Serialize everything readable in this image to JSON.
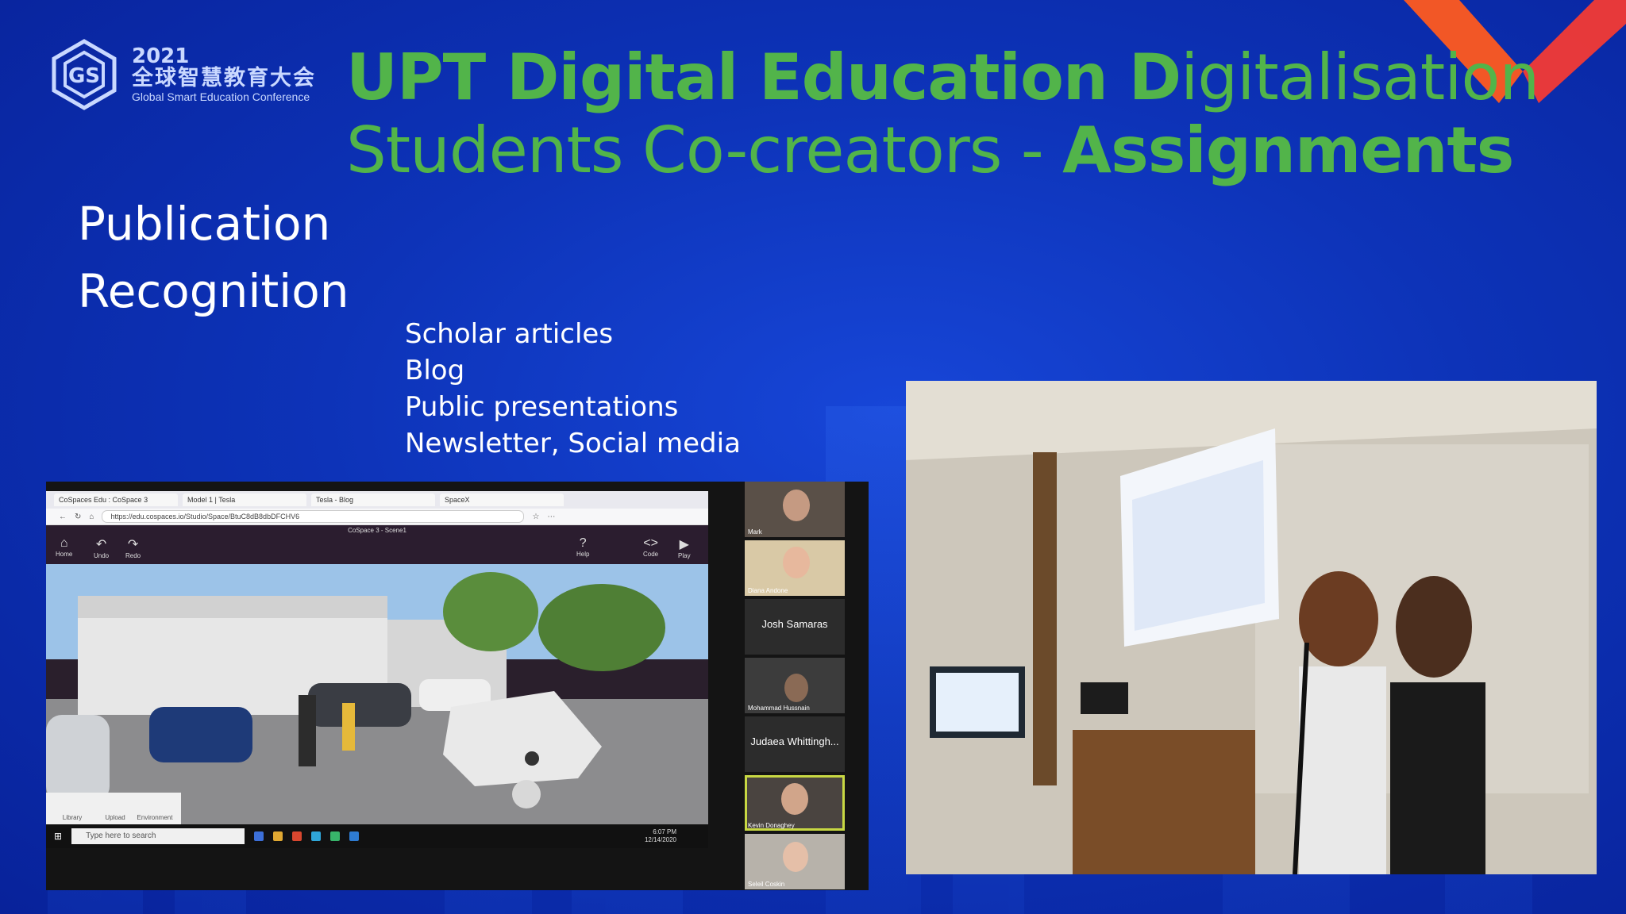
{
  "logo": {
    "year": "2021",
    "chinese_name": "全球智慧教育大会",
    "english_name": "Global Smart Education Conference"
  },
  "title": {
    "line1_bold": "UPT Digital Education D",
    "line1_regular": "igitalisation",
    "line2_regular": "Students Co-creators - ",
    "line2_bold": "Assignments"
  },
  "left_items": [
    "Publication",
    "Recognition"
  ],
  "right_items": [
    "Scholar articles",
    "Blog",
    "Public presentations",
    "Newsletter, Social media"
  ],
  "browser": {
    "tabs": [
      "CoSpaces Edu : CoSpace 3",
      "Model 1 | Tesla",
      "Tesla - Blog",
      "SpaceX"
    ],
    "url": "https://edu.cospaces.io/Studio/Space/BtuC8dB8dbDFCHV6",
    "app_title": "CoSpace 3 - Scene1",
    "toolbar_left": [
      "Home",
      "Undo",
      "Redo"
    ],
    "toolbar_right": [
      "Help",
      "Code",
      "Play"
    ],
    "bottom_tools": [
      "Library",
      "Upload",
      "Environment"
    ]
  },
  "taskbar": {
    "search_placeholder": "Type here to search",
    "time": "6:07 PM",
    "date": "12/14/2020"
  },
  "participants": [
    {
      "name": "Mark",
      "kind": "video"
    },
    {
      "name": "Diana Andone",
      "kind": "video"
    },
    {
      "name": "Josh Samaras",
      "kind": "name"
    },
    {
      "name": "Mohammad Hussnain",
      "kind": "video"
    },
    {
      "name": "Judaea Whittingh...",
      "kind": "name"
    },
    {
      "name": "Kevin Donaghey",
      "kind": "video"
    },
    {
      "name": "Seleil Coskin",
      "kind": "video"
    }
  ],
  "colors": {
    "title_green": "#52b44a",
    "background_blue": "#0d33b8",
    "corner_orange": "#ff5a1f",
    "active_speaker": "#c8d843"
  }
}
